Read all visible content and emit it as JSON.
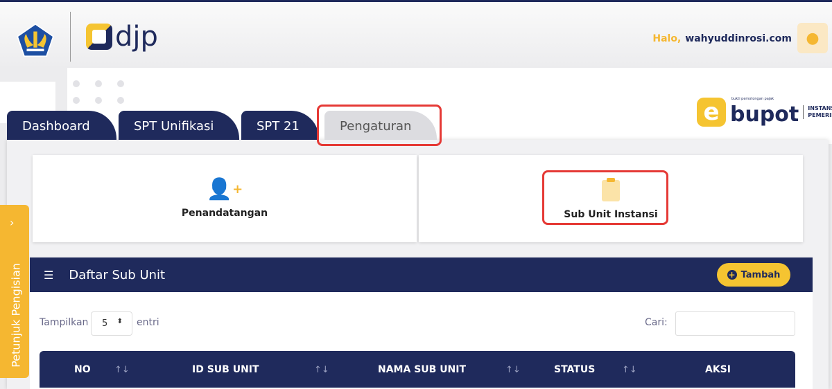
{
  "header": {
    "greeting": "Halo,",
    "username": "wahyuddinrosi.com",
    "djp_logo": "djp",
    "ebupot_logo": {
      "e": "e",
      "brand": "bupot",
      "tagline": "bukti pemotongan pajak",
      "line1": "INSTANSI",
      "line2": "PEMERINTAH"
    }
  },
  "tabs": [
    {
      "label": "Dashboard"
    },
    {
      "label": "SPT Unifikasi"
    },
    {
      "label": "SPT 21"
    },
    {
      "label": "Pengaturan",
      "active": true
    }
  ],
  "cards": [
    {
      "label": "Penandatangan",
      "icon": "user-plus-icon"
    },
    {
      "label": "Sub Unit Instansi",
      "icon": "clipboard-icon"
    }
  ],
  "list": {
    "title": "Daftar Sub Unit",
    "add_label": "Tambah",
    "show_label": "Tampilkan",
    "entries_value": "5",
    "entries_label": "entri",
    "search_label": "Cari:",
    "search_value": "",
    "columns": [
      "NO",
      "ID SUB UNIT",
      "NAMA SUB UNIT",
      "STATUS",
      "AKSI"
    ]
  },
  "sidebar": {
    "label": "Petunjuk Pengisian"
  },
  "colors": {
    "navy": "#1f2a5c",
    "accent": "#f5b731",
    "highlight": "#e53935"
  }
}
